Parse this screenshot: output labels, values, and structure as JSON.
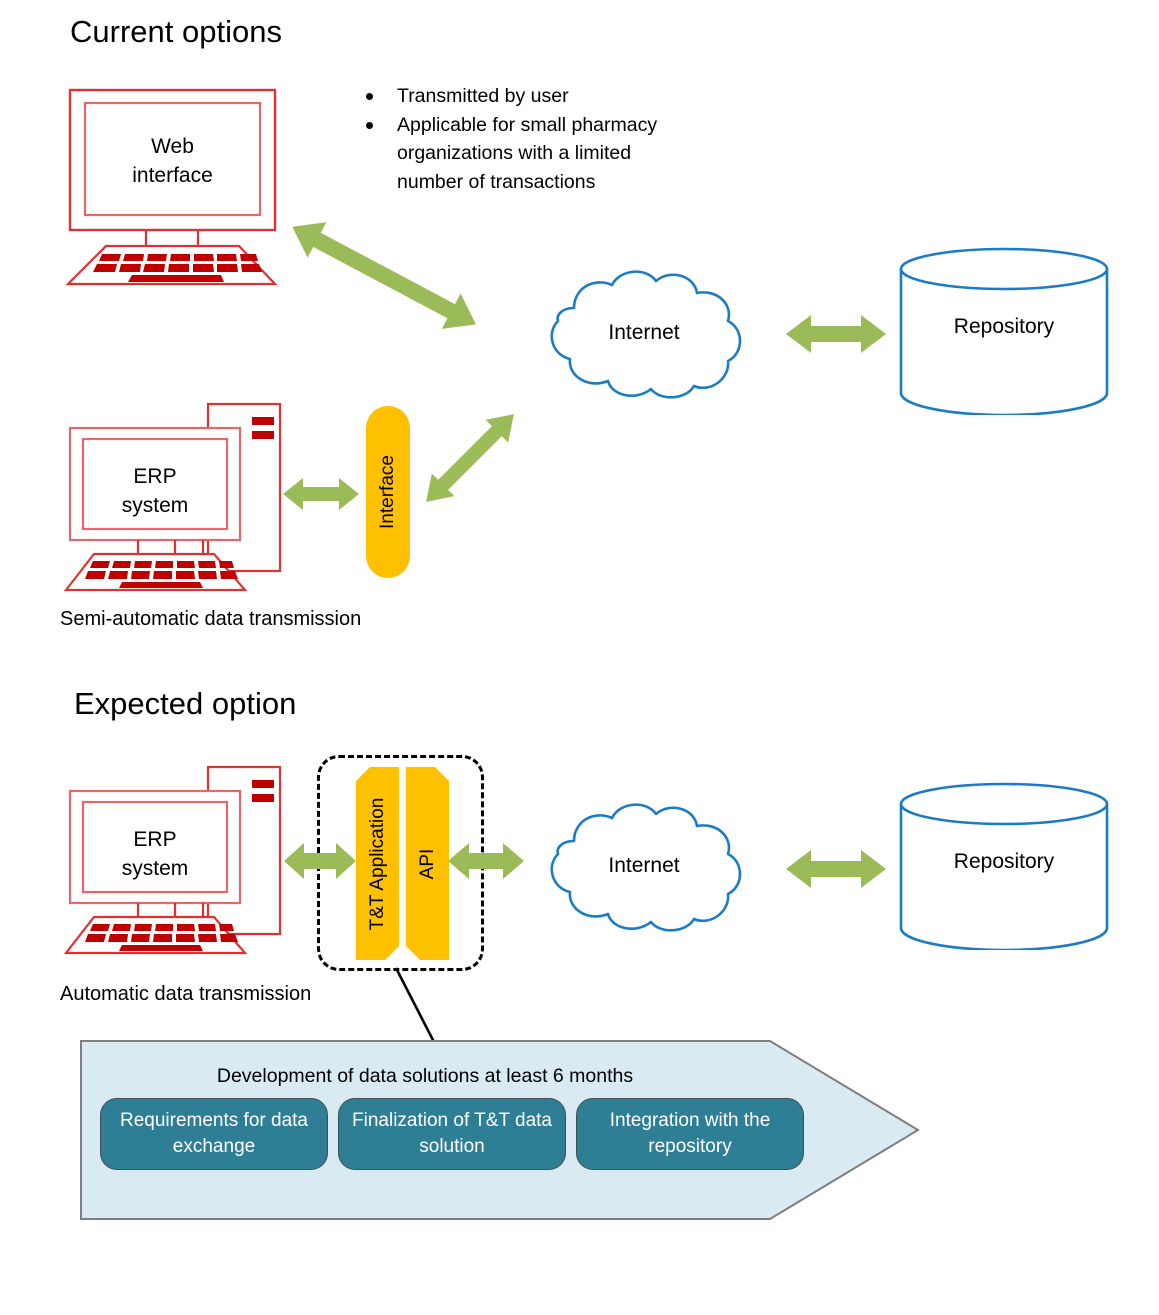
{
  "colors": {
    "red_outline": "#E03131",
    "red_key": "#C00000",
    "blue_outline": "#1B7CC4",
    "green_arrow": "#9BBB59",
    "orange": "#FFC000",
    "teal_step": "#2E7F96",
    "band_fill": "#DAEAF2",
    "band_border": "#7F7F7F",
    "text": "#000000"
  },
  "sections": {
    "current": {
      "title": "Current options",
      "caption": "Semi-automatic data transmission",
      "bullets": [
        "Transmitted by user",
        "Applicable for small pharmacy organizations with a limited number of transactions"
      ],
      "web_computer": {
        "line1": "Web",
        "line2": "interface"
      },
      "erp_computer": {
        "line1": "ERP",
        "line2": "system"
      },
      "interface_capsule": "Interface",
      "cloud": "Internet",
      "repository": "Repository"
    },
    "expected": {
      "title": "Expected option",
      "caption": "Automatic data transmission",
      "erp_computer": {
        "line1": "ERP",
        "line2": "system"
      },
      "app_slab": "T&T Application",
      "api_slab": "API",
      "cloud": "Internet",
      "repository": "Repository",
      "band": {
        "title": "Development of data solutions at least 6 months",
        "steps": [
          "Requirements for data exchange",
          "Finalization of T&T data solution",
          "Integration with the repository"
        ]
      }
    }
  }
}
